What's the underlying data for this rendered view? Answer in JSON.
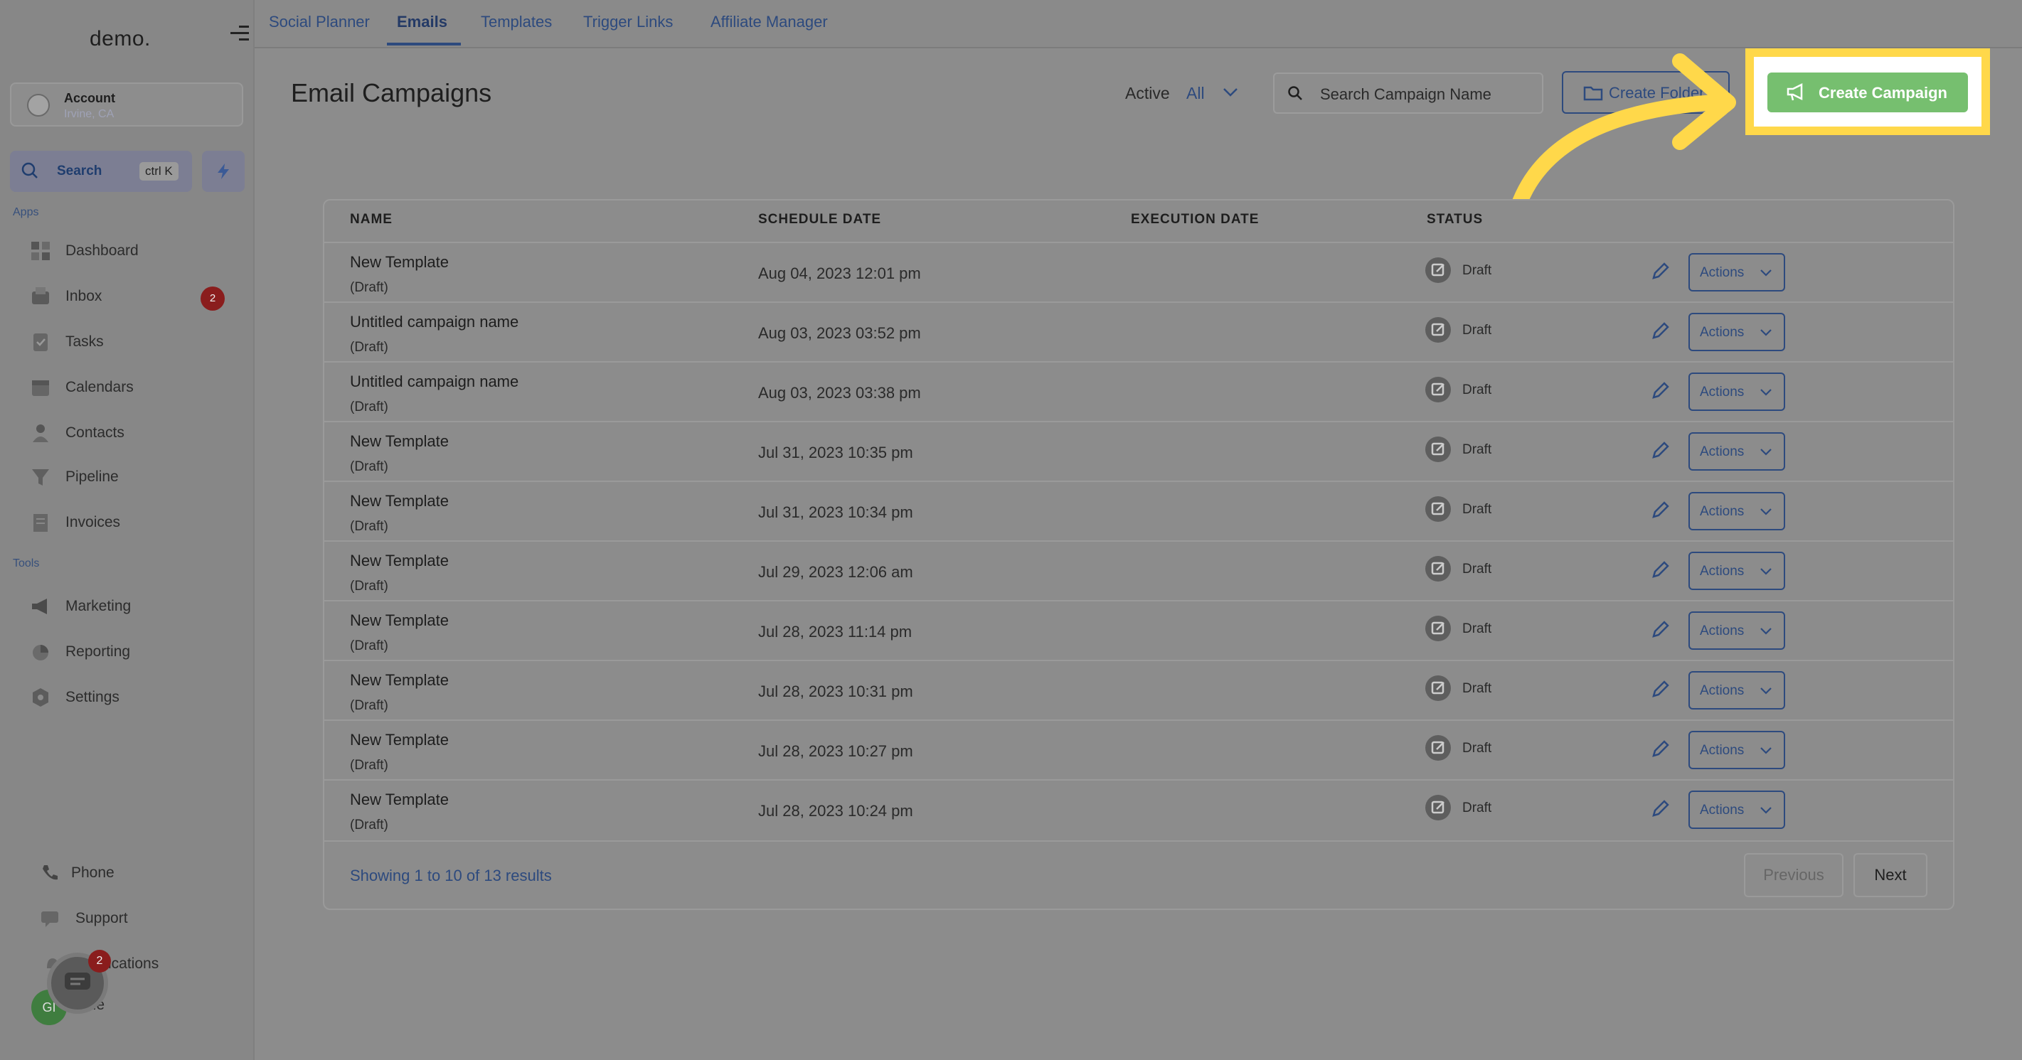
{
  "app": {
    "logo": "demo."
  },
  "sidebar": {
    "account": {
      "name": "Account",
      "location": "Irvine, CA"
    },
    "search": {
      "label": "Search",
      "shortcut": "ctrl K"
    },
    "sections": {
      "apps": "Apps",
      "tools": "Tools"
    },
    "apps": [
      {
        "label": "Dashboard",
        "icon": "dashboard-icon"
      },
      {
        "label": "Inbox",
        "icon": "inbox-icon",
        "badge": "2"
      },
      {
        "label": "Tasks",
        "icon": "tasks-icon"
      },
      {
        "label": "Calendars",
        "icon": "calendar-icon"
      },
      {
        "label": "Contacts",
        "icon": "contacts-icon"
      },
      {
        "label": "Pipeline",
        "icon": "pipeline-icon"
      },
      {
        "label": "Invoices",
        "icon": "invoices-icon"
      }
    ],
    "tools": [
      {
        "label": "Marketing",
        "icon": "megaphone-icon"
      },
      {
        "label": "Reporting",
        "icon": "pie-chart-icon"
      },
      {
        "label": "Settings",
        "icon": "gear-icon"
      }
    ],
    "bottom": [
      {
        "label": "Phone",
        "icon": "phone-icon"
      },
      {
        "label": "Support",
        "icon": "support-icon"
      },
      {
        "label": "ications",
        "icon": "bell-icon"
      },
      {
        "label": "ile",
        "icon": "profile-icon"
      }
    ],
    "chat_badge": "2",
    "avatar_initials": "GI"
  },
  "tabs": [
    {
      "label": "Social Planner",
      "active": false
    },
    {
      "label": "Emails",
      "active": true
    },
    {
      "label": "Templates",
      "active": false
    },
    {
      "label": "Trigger Links",
      "active": false
    },
    {
      "label": "Affiliate Manager",
      "active": false
    }
  ],
  "header": {
    "title": "Email Campaigns",
    "filter_label": "Active",
    "filter_value": "All",
    "search_placeholder": "Search Campaign Name",
    "create_folder": "Create Folder",
    "create_campaign": "Create Campaign"
  },
  "table": {
    "columns": {
      "name": "NAME",
      "schedule": "SCHEDULE DATE",
      "execution": "EXECUTION DATE",
      "status": "STATUS"
    },
    "actions_label": "Actions",
    "rows": [
      {
        "name": "New Template",
        "sub": "(Draft)",
        "schedule": "Aug 04, 2023 12:01 pm",
        "status": "Draft"
      },
      {
        "name": "Untitled campaign name",
        "sub": "(Draft)",
        "schedule": "Aug 03, 2023 03:52 pm",
        "status": "Draft"
      },
      {
        "name": "Untitled campaign name",
        "sub": "(Draft)",
        "schedule": "Aug 03, 2023 03:38 pm",
        "status": "Draft"
      },
      {
        "name": "New Template",
        "sub": "(Draft)",
        "schedule": "Jul 31, 2023 10:35 pm",
        "status": "Draft"
      },
      {
        "name": "New Template",
        "sub": "(Draft)",
        "schedule": "Jul 31, 2023 10:34 pm",
        "status": "Draft"
      },
      {
        "name": "New Template",
        "sub": "(Draft)",
        "schedule": "Jul 29, 2023 12:06 am",
        "status": "Draft"
      },
      {
        "name": "New Template",
        "sub": "(Draft)",
        "schedule": "Jul 28, 2023 11:14 pm",
        "status": "Draft"
      },
      {
        "name": "New Template",
        "sub": "(Draft)",
        "schedule": "Jul 28, 2023 10:31 pm",
        "status": "Draft"
      },
      {
        "name": "New Template",
        "sub": "(Draft)",
        "schedule": "Jul 28, 2023 10:27 pm",
        "status": "Draft"
      },
      {
        "name": "New Template",
        "sub": "(Draft)",
        "schedule": "Jul 28, 2023 10:24 pm",
        "status": "Draft"
      }
    ],
    "showing": "Showing 1 to 10 of 13 results",
    "previous": "Previous",
    "next": "Next"
  },
  "colors": {
    "accent": "#2d4a7e",
    "create_button": "#76bf6f",
    "highlight": "#ffd84a",
    "badge": "#8a1d1d"
  }
}
